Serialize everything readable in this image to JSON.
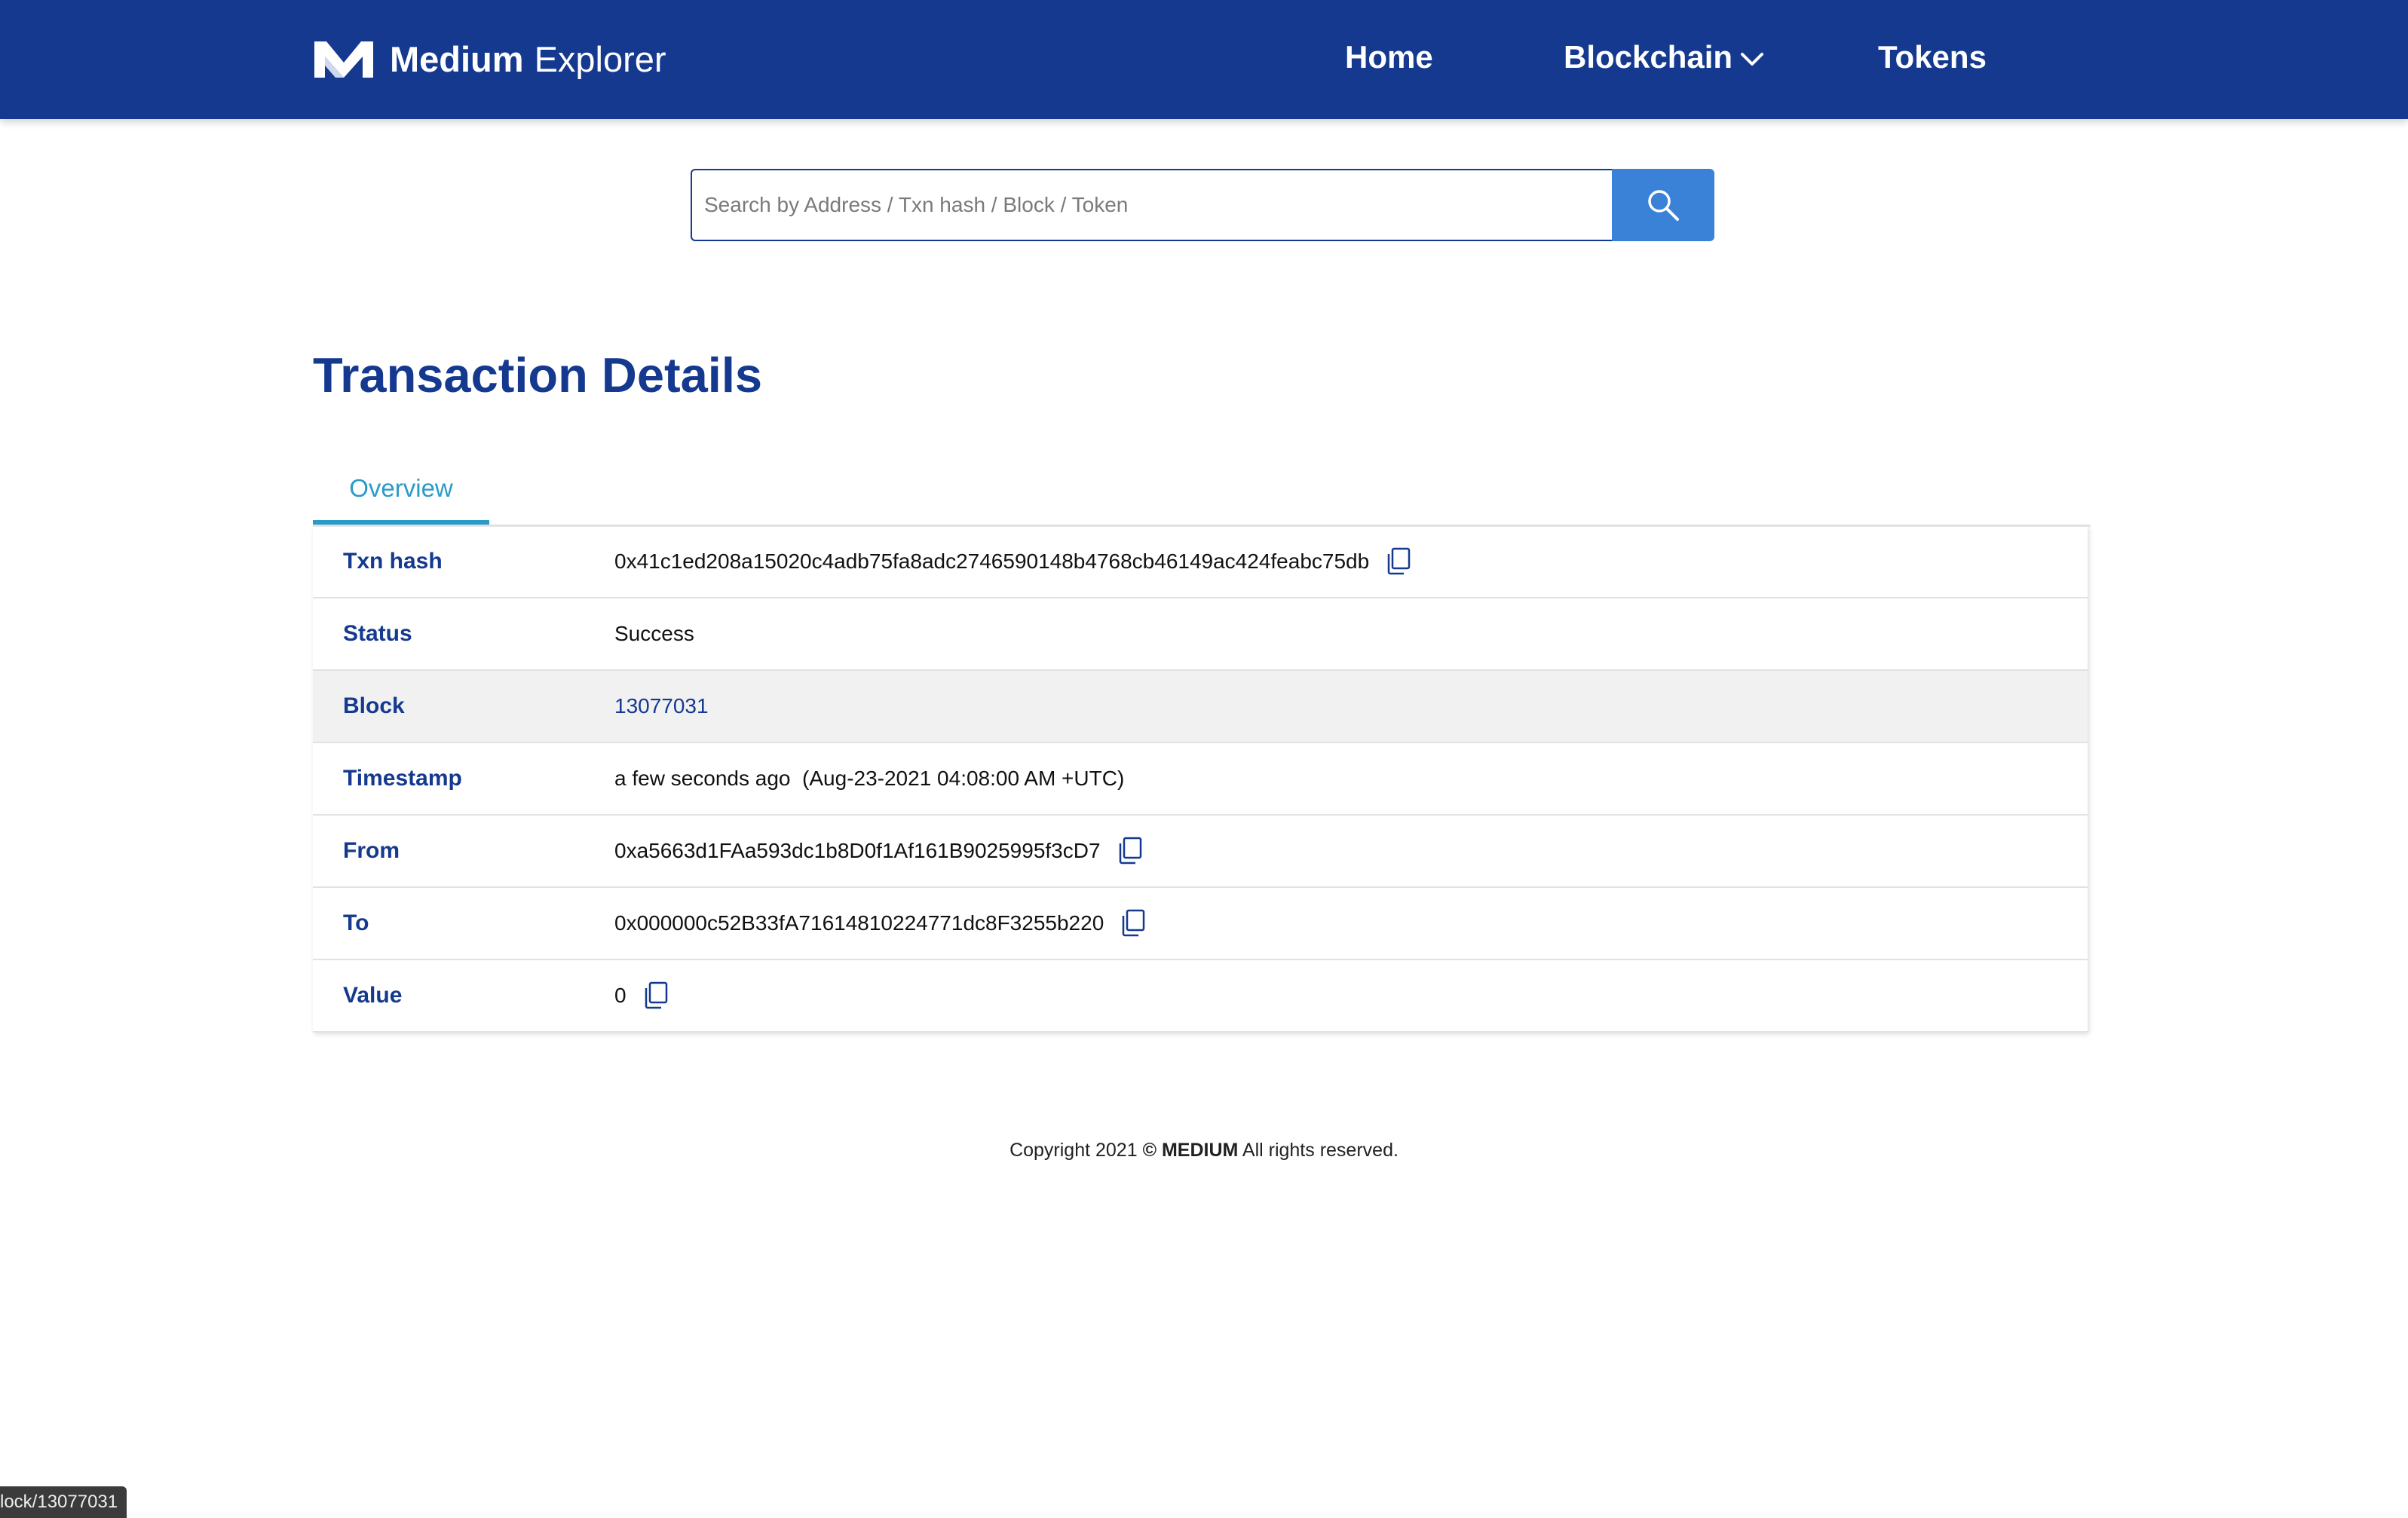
{
  "header": {
    "brand": "Medium",
    "product": "Explorer",
    "nav": {
      "home": "Home",
      "blockchain": "Blockchain",
      "tokens": "Tokens"
    }
  },
  "search": {
    "placeholder": "Search by Address / Txn hash / Block / Token",
    "value": ""
  },
  "page": {
    "title": "Transaction Details"
  },
  "tabs": {
    "overview": "Overview"
  },
  "details": {
    "txn_hash": {
      "label": "Txn hash",
      "value": "0x41c1ed208a15020c4adb75fa8adc2746590148b4768cb46149ac424feabc75db"
    },
    "status": {
      "label": "Status",
      "value": "Success"
    },
    "block": {
      "label": "Block",
      "value": "13077031"
    },
    "timestamp": {
      "label": "Timestamp",
      "value": "a few seconds ago  (Aug-23-2021 04:08:00 AM +UTC)"
    },
    "from": {
      "label": "From",
      "value": "0xa5663d1FAa593dc1b8D0f1Af161B9025995f3cD7"
    },
    "to": {
      "label": "To",
      "value": "0x000000c52B33fA71614810224771dc8F3255b220"
    },
    "value": {
      "label": "Value",
      "value": "0"
    }
  },
  "footer": {
    "prefix": "Copyright 2021 ",
    "brand": "© MEDIUM",
    "suffix": " All rights reserved."
  },
  "status_bar": {
    "url": "lock/13077031"
  },
  "colors": {
    "navbar": "#14398f",
    "accent": "#3a82d8",
    "tab_active": "#2a9bc8",
    "label": "#14398f",
    "row_shaded": "#f1f1f1"
  },
  "icons": {
    "logo": "medium-m-logo-icon",
    "dropdown": "chevron-down-icon",
    "search": "search-icon",
    "copy": "copy-icon"
  }
}
